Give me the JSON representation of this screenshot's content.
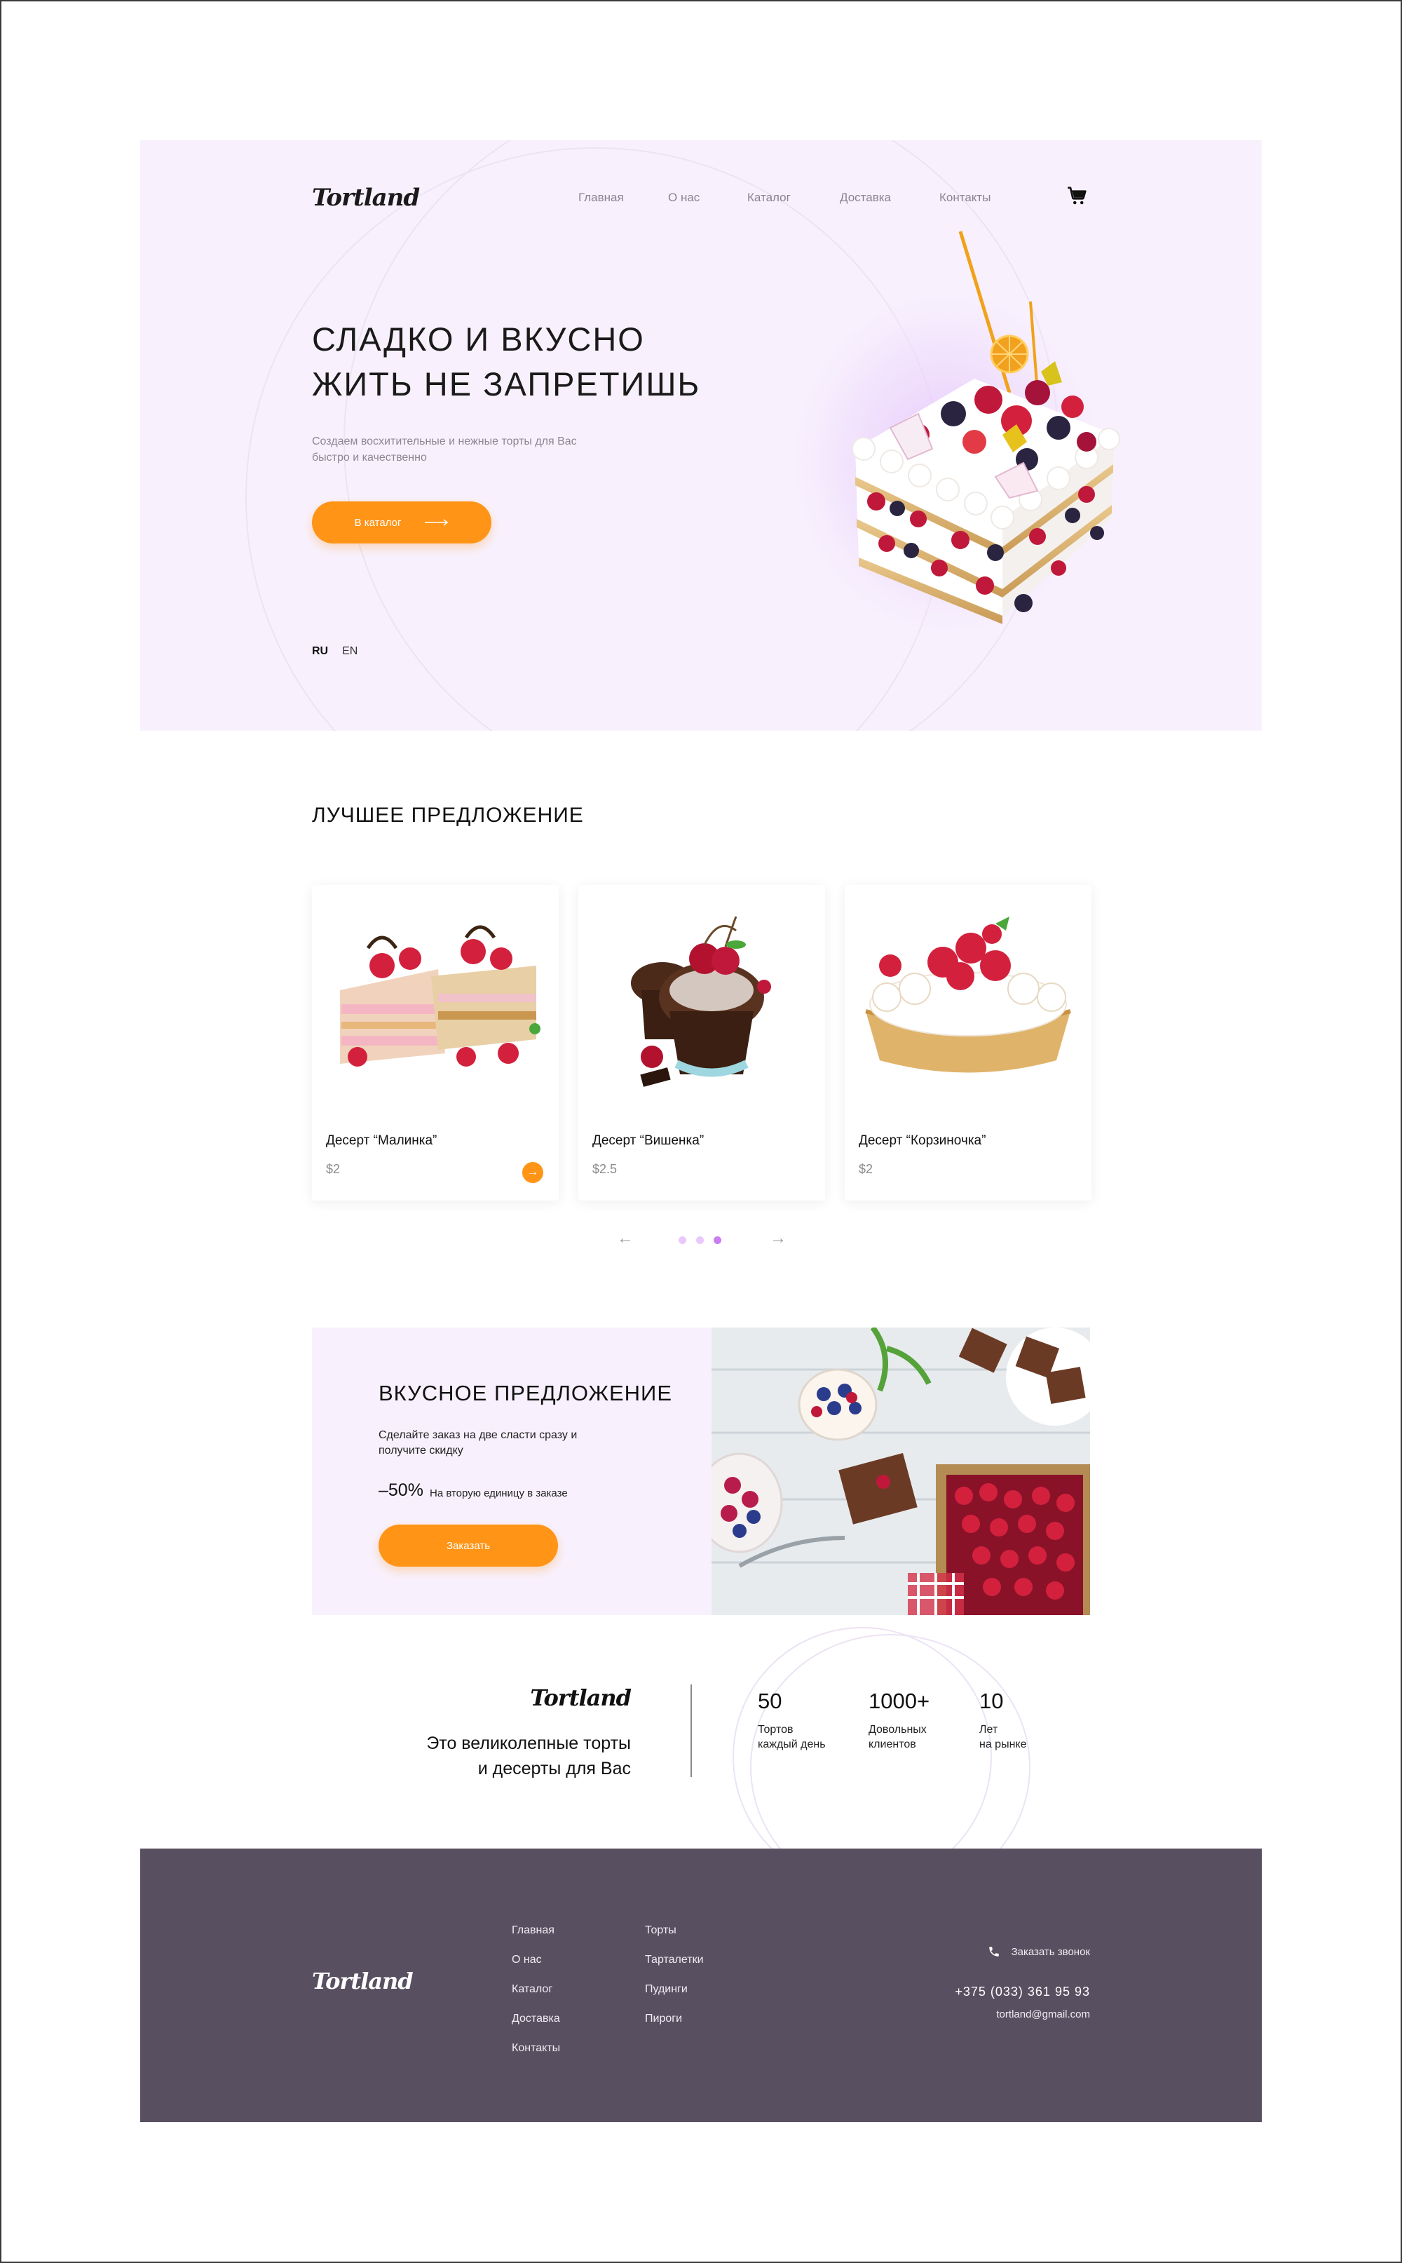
{
  "brand": {
    "logo_text": "Tortland"
  },
  "nav": {
    "items": [
      "Главная",
      "О нас",
      "Каталог",
      "Доставка",
      "Контакты"
    ]
  },
  "hero": {
    "title_line1": "СЛАДКО И ВКУСНО",
    "title_line2": "ЖИТЬ НЕ ЗАПРЕТИШЬ",
    "subtitle_line1": "Создаем восхитительные и нежные торты для Вас",
    "subtitle_line2": "быстро и качественно",
    "cta_label": "В каталог",
    "languages": {
      "ru": "RU",
      "en": "EN"
    }
  },
  "best_offer": {
    "title": "ЛУЧШЕЕ ПРЕДЛОЖЕНИЕ",
    "cards": [
      {
        "name": "Десерт “Малинка”",
        "price": "$2"
      },
      {
        "name": "Десерт “Вишенка”",
        "price": "$2.5"
      },
      {
        "name": "Десерт “Корзиночка”",
        "price": "$2"
      }
    ],
    "pager": {
      "prev": "←",
      "next": "→",
      "active_dot": 3,
      "dot_count": 3
    }
  },
  "promo": {
    "title": "ВКУСНОЕ ПРЕДЛОЖЕНИЕ",
    "text_line1": "Сделайте заказ на две сласти сразу и",
    "text_line2": "получите скидку",
    "discount": "–50%",
    "discount_note": "На вторую единицу в заказе",
    "cta_label": "Заказать"
  },
  "about": {
    "slogan_line1": "Это великолепные торты",
    "slogan_line2": "и десерты для Вас",
    "stats": [
      {
        "number": "50",
        "label_line1": "Тортов",
        "label_line2": "каждый день"
      },
      {
        "number": "1000+",
        "label_line1": "Довольных",
        "label_line2": "клиентов"
      },
      {
        "number": "10",
        "label_line1": "Лет",
        "label_line2": "на рынке"
      }
    ]
  },
  "footer": {
    "nav_col1": [
      "Главная",
      "О нас",
      "Каталог",
      "Доставка",
      "Контакты"
    ],
    "nav_col2": [
      "Торты",
      "Тарталетки",
      "Пудинги",
      "Пироги"
    ],
    "call_label": "Заказать звонок",
    "phone": "+375 (033) 361 95 93",
    "email": "tortland@gmail.com"
  },
  "colors": {
    "accent": "#ff9416",
    "hero_bg": "#f8f1fd",
    "footer_bg": "#585061",
    "dot_active": "#c97df0",
    "dot_inactive": "#e9c8fb"
  },
  "icons": [
    "cart-icon",
    "arrow-right-icon",
    "phone-icon"
  ]
}
